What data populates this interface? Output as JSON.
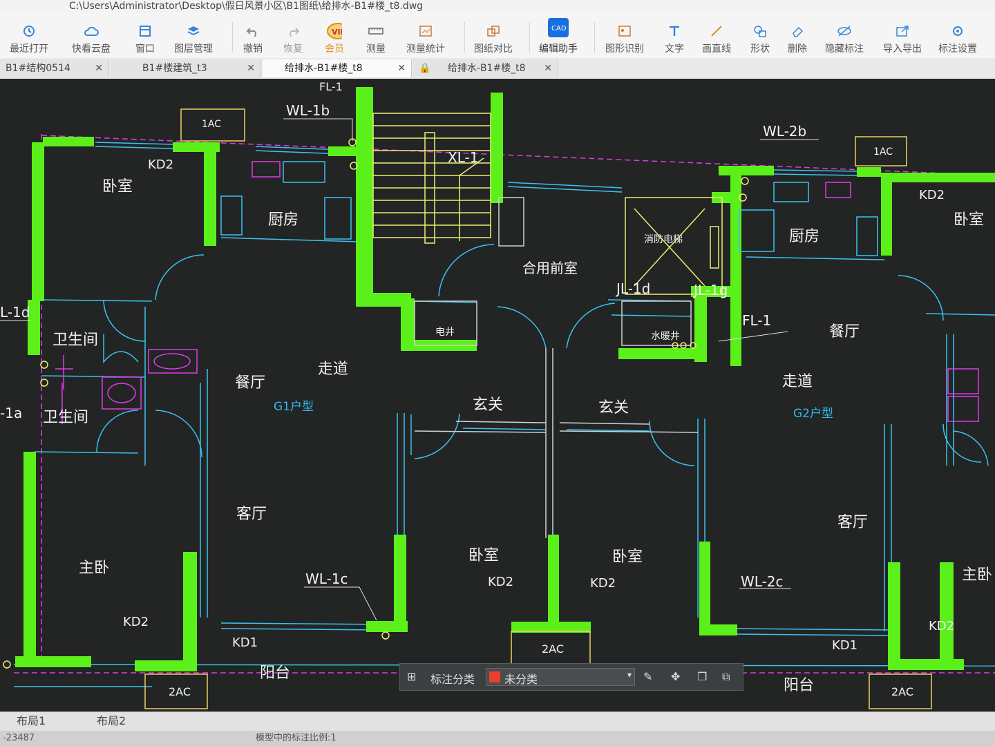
{
  "title": "C:\\Users\\Administrator\\Desktop\\假日风景小区\\B1图纸\\给排水-B1#楼_t8.dwg",
  "toolbar": {
    "recent": "最近打开",
    "cloud": "快看云盘",
    "window": "窗口",
    "layers": "图层管理",
    "undo": "撤销",
    "redo": "恢复",
    "vip": "会员",
    "measure": "测量",
    "measure_stats": "测量统计",
    "compare": "图纸对比",
    "edit_assist": "编辑助手",
    "shape_recog": "图形识别",
    "text": "文字",
    "draw_line": "画直线",
    "shape": "形状",
    "delete": "删除",
    "hide_annot": "隐藏标注",
    "import_export": "导入导出",
    "annot_settings": "标注设置"
  },
  "tabs": [
    {
      "label": "B1#结构0514",
      "close": "✕"
    },
    {
      "label": "B1#楼建筑_t3",
      "close": "✕"
    },
    {
      "label": "给排水-B1#楼_t8",
      "close": "✕"
    },
    {
      "label": "给排水-B1#楼_t8",
      "close": "✕"
    }
  ],
  "drawing": {
    "rooms": {
      "bedroom_tl": "卧室",
      "kitchen_l": "厨房",
      "stair_mark": "XL-1",
      "shared_lobby": "合用前室",
      "fire_elevator": "消防电梯",
      "kitchen_r": "厨房",
      "bedroom_tr": "卧室",
      "bath1": "卫生间",
      "bath2": "卫生间",
      "dining_l": "餐厅",
      "corridor_l": "走道",
      "elec_shaft": "电井",
      "water_shaft": "水暖井",
      "dining_r": "餐厅",
      "corridor_r": "走道",
      "foyer_l": "玄关",
      "foyer_r": "玄关",
      "living_l": "客厅",
      "master_l": "主卧",
      "bedroom_cl": "卧室",
      "bedroom_cr": "卧室",
      "living_r": "客厅",
      "master_r": "主卧",
      "balcony_l": "阳台",
      "balcony_r": "阳台"
    },
    "types": {
      "g1": "G1户型",
      "g2": "G2户型"
    },
    "codes": {
      "wl1b": "WL-1b",
      "wl2b": "WL-2b",
      "wl1c": "WL-1c",
      "wl2c": "WL-2c",
      "fl1_top": "FL-1",
      "fl1": "FL-1",
      "jl1d": "JL-1d",
      "jl1g": "JL-1g",
      "l1d": "L-1d",
      "l1a": "-1a",
      "kd2_tl": "KD2",
      "kd2_tr": "KD2",
      "kd2_bl": "KD2",
      "kd2_cl": "KD2",
      "kd2_cr": "KD2",
      "kd2_br": "KD2",
      "kd1_l": "KD1",
      "kd1_r": "KD1",
      "ac1_l": "1AC",
      "ac1_r": "1AC",
      "ac2_l": "2AC",
      "ac2_c": "2AC",
      "ac2_r": "2AC"
    }
  },
  "floatbar": {
    "label": "标注分类",
    "category": "未分类",
    "category_color": "#e8402a"
  },
  "layout": {
    "tab1": "布局1",
    "tab2": "布局2"
  },
  "status": {
    "coord": "-23487",
    "scale_text": "模型中的标注比例:1"
  },
  "colors": {
    "wall": "#5cf01a",
    "cyan": "#3ac3f0",
    "magenta": "#e23ae8",
    "yellow": "#f0ee70",
    "canvas": "#222524"
  }
}
